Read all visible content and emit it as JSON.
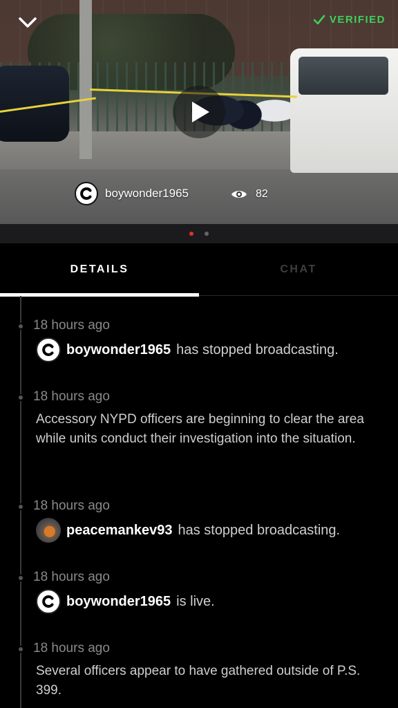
{
  "video": {
    "verified_label": "VERIFIED",
    "owner": {
      "username": "boywonder1965"
    },
    "view_count": "82",
    "pager": {
      "total": 2,
      "active_index": 0
    },
    "colors": {
      "verified": "#3ecf5a",
      "active_dot": "#e0322b"
    },
    "icons": {
      "back": "chevron-down-icon",
      "verified": "checkmark-icon",
      "play": "play-icon",
      "views": "eye-icon"
    }
  },
  "tabs": [
    {
      "label": "DETAILS",
      "active": true
    },
    {
      "label": "CHAT",
      "active": false
    }
  ],
  "timeline": [
    {
      "time": "18 hours ago",
      "type": "event",
      "user": "boywonder1965",
      "action": "has stopped broadcasting.",
      "avatar": "citizen-logo"
    },
    {
      "time": "18 hours ago",
      "type": "update",
      "text": "Accessory NYPD officers are beginning to clear the area while units conduct their investigation into the situation."
    },
    {
      "time": "18 hours ago",
      "type": "event",
      "user": "peacemankev93",
      "action": "has stopped broadcasting.",
      "avatar": "photo"
    },
    {
      "time": "18 hours ago",
      "type": "event",
      "user": "boywonder1965",
      "action": "is live.",
      "avatar": "citizen-logo"
    },
    {
      "time": "18 hours ago",
      "type": "update",
      "text": "Several officers appear to have gathered outside of P.S. 399."
    }
  ]
}
